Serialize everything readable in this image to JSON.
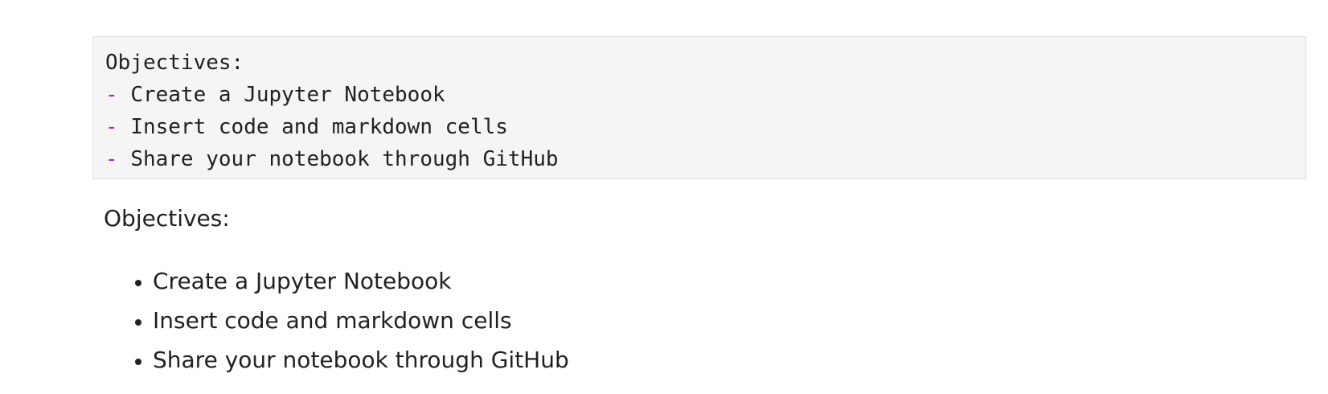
{
  "source_cell": {
    "heading": "Objectives:",
    "bullet_marker": "-",
    "items": [
      "Create a Jupyter Notebook",
      "Insert code and markdown cells",
      "Share your notebook through GitHub"
    ]
  },
  "rendered_cell": {
    "heading": "Objectives:",
    "items": [
      "Create a Jupyter Notebook",
      "Insert code and markdown cells",
      "Share your notebook through GitHub"
    ]
  },
  "colors": {
    "cell_background": "#f5f5f5",
    "markdown_list_marker": "#9b1fe8",
    "text": "#212121"
  }
}
